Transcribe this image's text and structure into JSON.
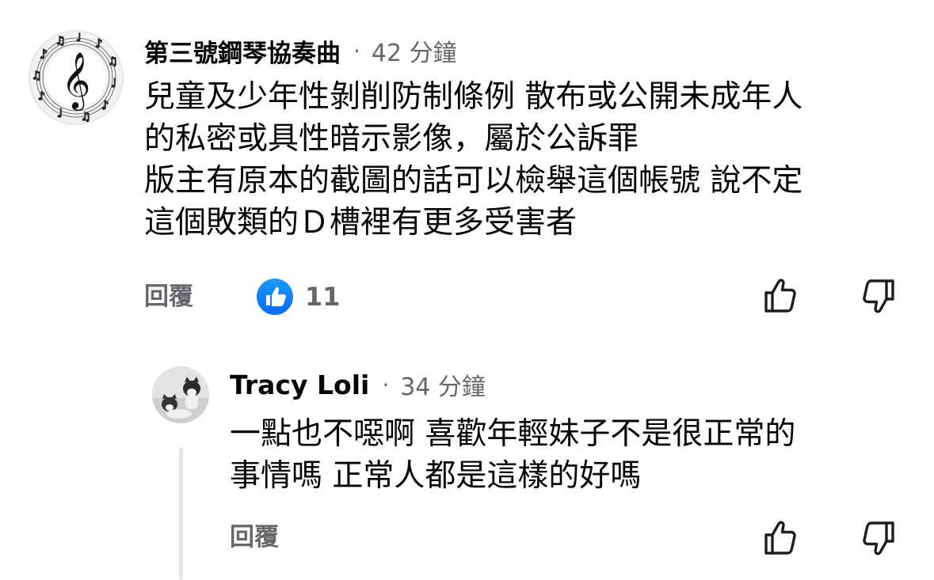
{
  "comment": {
    "author": "第三號鋼琴協奏曲",
    "separator": "·",
    "time": "42 分鐘",
    "lines": [
      "兒童及少年性剝削防制條例 散布或公開未成年人",
      "的私密或具性暗示影像，屬於公訴罪",
      "版主有原本的截圖的話可以檢舉這個帳號 說不定",
      "這個敗類的Ｄ槽裡有更多受害者"
    ],
    "reply_label": "回覆",
    "like_count": "11",
    "avatar_icon": "treble-clef-music-notes-icon"
  },
  "reply": {
    "author": "Tracy Loli",
    "separator": "·",
    "time": "34 分鐘",
    "lines": [
      "一點也不噁啊 喜歡年輕妹子不是很正常的",
      "事情嗎 正常人都是這樣的好嗎"
    ],
    "reply_label": "回覆",
    "avatar_icon": "cats-photo-avatar"
  },
  "colors": {
    "text_primary": "#050505",
    "text_secondary": "#65676b",
    "like_blue": "#0866ff",
    "thread_line": "#e4e6eb"
  }
}
